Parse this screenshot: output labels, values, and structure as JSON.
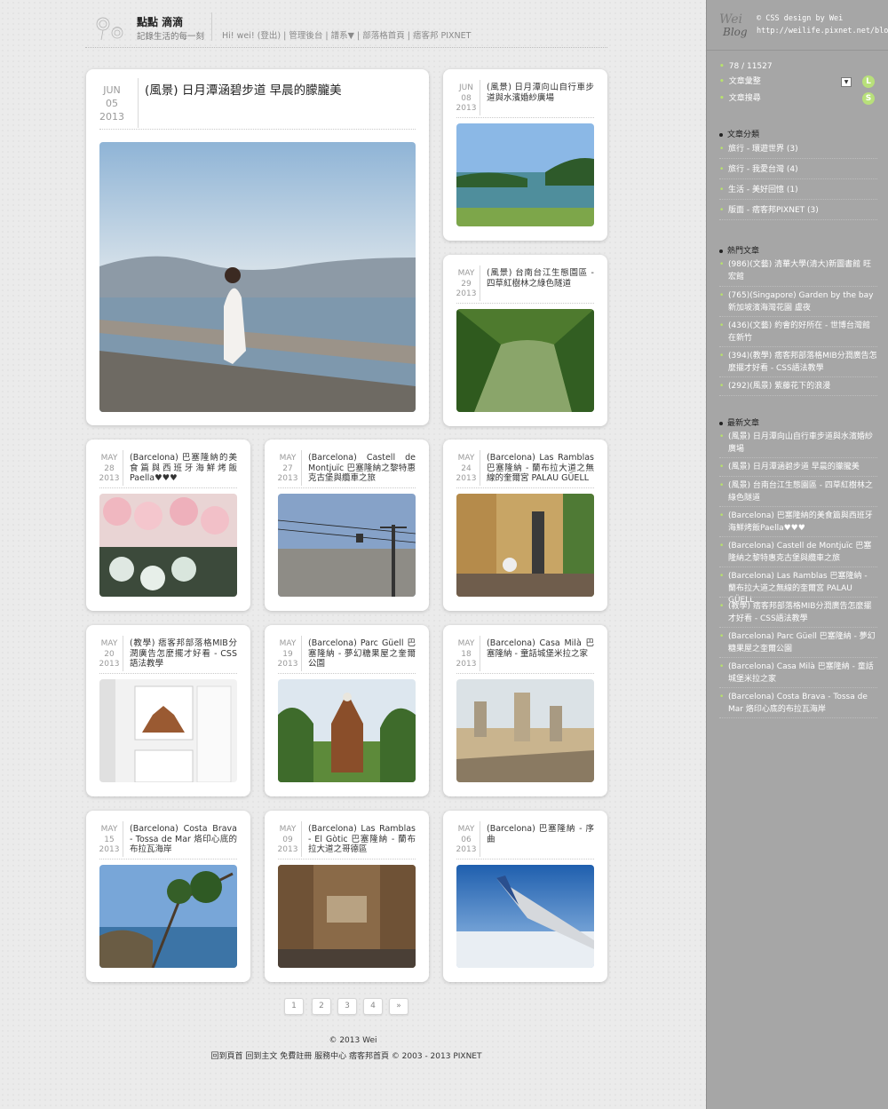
{
  "header": {
    "site_title": "點點 滴滴",
    "site_subtitle": "記錄生活的每一刻",
    "nav": [
      "Hi! wei! (登出)",
      "管理後台",
      "譜系▼",
      "部落格首頁",
      "痞客邦 PIXNET"
    ]
  },
  "posts": [
    {
      "month": "JUN",
      "day": "05",
      "year": "2013",
      "title": "(風景) 日月潭涵碧步道 早晨的朦朧美"
    },
    {
      "month": "JUN",
      "day": "08",
      "year": "2013",
      "title": "(風景) 日月潭向山自行車步道與水濱婚紗廣場"
    },
    {
      "month": "MAY",
      "day": "29",
      "year": "2013",
      "title": "(風景) 台南台江生態園區 - 四草紅樹林之綠色隧道"
    },
    {
      "month": "MAY",
      "day": "28",
      "year": "2013",
      "title": "(Barcelona) 巴塞隆納的美食篇與西班牙海鮮烤飯Paella♥♥♥"
    },
    {
      "month": "MAY",
      "day": "27",
      "year": "2013",
      "title": "(Barcelona) Castell de Montjuïc 巴塞隆納之黎特惠克古堡與纜車之旅"
    },
    {
      "month": "MAY",
      "day": "24",
      "year": "2013",
      "title": "(Barcelona) Las Ramblas 巴塞隆納 - 蘭布拉大道之無線的奎爾宮 PALAU GÜELL"
    },
    {
      "month": "MAY",
      "day": "20",
      "year": "2013",
      "title": "(教學) 痞客邦部落格MIB分潤廣告怎麼擺才好看 - CSS語法教學"
    },
    {
      "month": "MAY",
      "day": "19",
      "year": "2013",
      "title": "(Barcelona) Parc Güell 巴塞隆納 - 夢幻糖果屋之奎爾公園"
    },
    {
      "month": "MAY",
      "day": "18",
      "year": "2013",
      "title": "(Barcelona) Casa Milà 巴塞隆納 - 童話城堡米拉之家"
    },
    {
      "month": "MAY",
      "day": "15",
      "year": "2013",
      "title": "(Barcelona) Costa Brava - Tossa de Mar 烙印心底的布拉瓦海岸"
    },
    {
      "month": "MAY",
      "day": "09",
      "year": "2013",
      "title": "(Barcelona) Las Ramblas - El Gòtic 巴塞隆納 - 蘭布拉大道之哥德區"
    },
    {
      "month": "MAY",
      "day": "06",
      "year": "2013",
      "title": "(Barcelona) 巴塞隆納 - 序曲"
    }
  ],
  "pagination": [
    "1",
    "2",
    "3",
    "4",
    "»"
  ],
  "footer": {
    "copyright": "© 2013 Wei",
    "links": "回到頁首 回到主文 免費註冊 服務中心 痞客邦首頁 © 2003 - 2013 PIXNET"
  },
  "sidebar": {
    "credit_line1": "© CSS design by Wei",
    "credit_line2": "http://weilife.pixnet.net/blog",
    "logo_text": "Wei Blog",
    "stats": "78  /  11527",
    "archive_label": "文章彙整",
    "search_label": "文章搜尋",
    "categories_heading": "文章分類",
    "categories": [
      "旅行 - 環遊世界 (3)",
      "旅行 - 我愛台灣 (4)",
      "生活 - 美好回憶 (1)",
      "版面 - 痞客邦PIXNET (3)"
    ],
    "hot_heading": "熱門文章",
    "hot": [
      "(986)(文藝) 清華大學(清大)新圖書館 旺宏館",
      "(765)(Singapore) Garden by the bay 新加坡濱海灣花園 盧夜",
      "(436)(文藝) 約會的好所在 - 世博台灣館在新竹",
      "(394)(教學) 痞客邦部落格MIB分潤廣告怎麼擺才好看 - CSS語法教學",
      "(292)(風景) 紫藤花下的浪漫"
    ],
    "latest_heading": "最新文章",
    "latest": [
      "(風景) 日月潭向山自行車步道與水濱婚紗廣場",
      "(風景) 日月潭涵碧步道 早晨的朦朧美",
      "(風景) 台南台江生態園區 - 四草紅樹林之綠色隧道",
      "(Barcelona) 巴塞隆納的美食篇與西班牙海鮮烤飯Paella♥♥♥",
      "(Barcelona) Castell de Montjuïc 巴塞隆納之黎特惠克古堡與纜車之旅",
      "(Barcelona) Las Ramblas 巴塞隆納 - 蘭布拉大道之無線的奎爾宮 PALAU GÜELL",
      "(教學) 痞客邦部落格MIB分潤廣告怎麼擺才好看 - CSS語法教學",
      "(Barcelona) Parc Güell 巴塞隆納 - 夢幻糖果屋之奎爾公園",
      "(Barcelona) Casa Milà 巴塞隆納 - 童話城堡米拉之家",
      "(Barcelona) Costa Brava - Tossa de Mar 烙印心底的布拉瓦海岸"
    ]
  },
  "colors": {
    "sidebar_bg": "#a6a6a6",
    "accent_green": "#b7e26c",
    "card_bg": "#ffffff"
  }
}
